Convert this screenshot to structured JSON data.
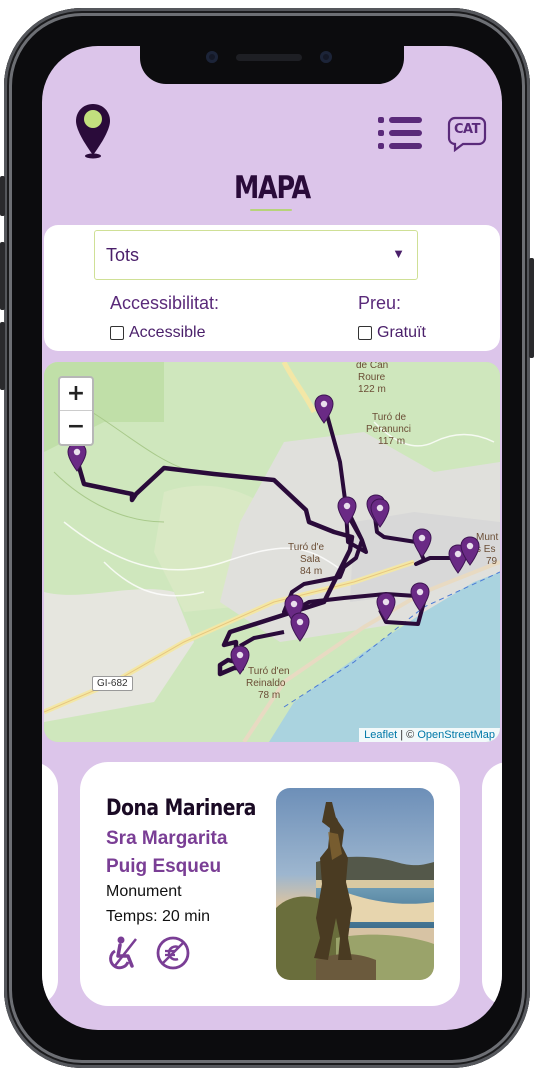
{
  "header": {
    "title": "MAPA",
    "language": "CAT"
  },
  "filters": {
    "category_select": "Tots",
    "accessibility_label": "Accessibilitat:",
    "accessible_checkbox": "Accessible",
    "price_label": "Preu:",
    "free_checkbox": "Gratuït"
  },
  "map": {
    "zoom_in": "+",
    "zoom_out": "−",
    "labels": [
      {
        "text": "de Can"
      },
      {
        "text": "Roure"
      },
      {
        "text": "122 m"
      },
      {
        "text": "Turó de"
      },
      {
        "text": "Peranunci"
      },
      {
        "text": "117 m"
      },
      {
        "text": "Turó d'e"
      },
      {
        "text": "Sala"
      },
      {
        "text": "84 m"
      },
      {
        "text": "Turó d'en"
      },
      {
        "text": "Reinaldo"
      },
      {
        "text": "78 m"
      },
      {
        "text": "Munt"
      },
      {
        "text": "s Es"
      },
      {
        "text": "79"
      },
      {
        "text": "GI-682"
      }
    ],
    "attribution_leaflet": "Leaflet",
    "attribution_separator": "| ©",
    "attribution_osm": "OpenStreetMap",
    "marker_color": "#6a2a85",
    "route_color": "#2a0b3a"
  },
  "card": {
    "name": "Dona Marinera",
    "author": "Sra Margarita Puig Esqueu",
    "type": "Monument",
    "time": "Temps: 20 min",
    "icons": [
      "wheelchair-icon",
      "no-cost-icon"
    ]
  },
  "colors": {
    "background": "#dcc5ea",
    "primary": "#4a1f6a",
    "accent": "#b7d37a"
  }
}
